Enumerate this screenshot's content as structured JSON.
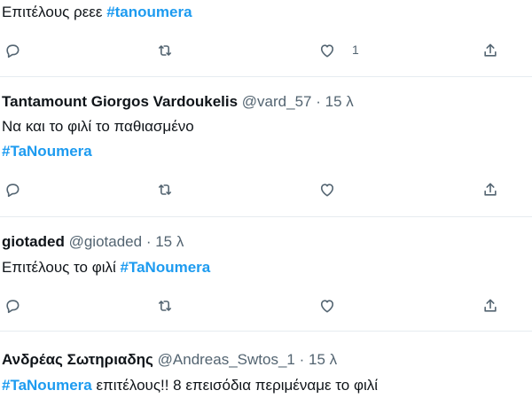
{
  "tweets": [
    {
      "name": "",
      "handle": "",
      "time": "",
      "text_before": "Επιτέλους ρεεε ",
      "hashtag": "#tanoumera",
      "text_after": "",
      "like_count": "1"
    },
    {
      "name": "Tantamount Giorgos Vardoukelis",
      "handle": "@vard_57",
      "time": "15 λ",
      "line1": "Να και το φιλί το παθιασμένο",
      "hashtag": "#TaNoumera"
    },
    {
      "name": "giotaded",
      "handle": "@giotaded",
      "time": "15 λ",
      "text_before": "Επιτέλους το φιλί ",
      "hashtag": "#TaNoumera"
    },
    {
      "name": "Ανδρέας Σωτηριαδης",
      "handle": "@Andreas_Swtos_1",
      "time": "15 λ",
      "hashtag": "#TaNoumera",
      "text_after": " επιτέλους!! 8 επεισόδια περιμέναμε το φιλί"
    }
  ],
  "separator": "·",
  "icons": [
    "reply-icon",
    "retweet-icon",
    "like-icon",
    "share-icon"
  ],
  "colors": {
    "hashtag": "#1d9bf0",
    "muted": "#536471",
    "text": "#0f1419",
    "divider": "#e6ecf0"
  }
}
